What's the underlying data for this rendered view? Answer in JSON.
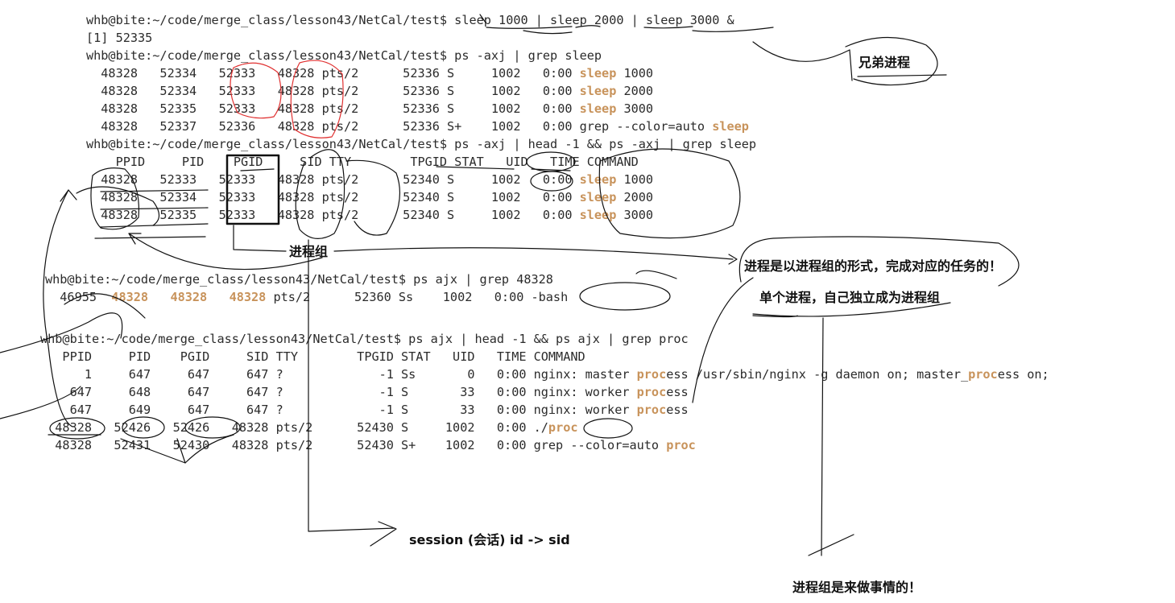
{
  "colors": {
    "background": "#ffffff",
    "terminal_text": "#2b2b2b",
    "match_highlight": "#c8935b",
    "red_ink": "#e03030",
    "pen_ink": "#111111"
  },
  "terminal": {
    "block1": {
      "cmd1": "whb@bite:~/code/merge_class/lesson43/NetCal/test$ sleep 1000 | sleep 2000 | sleep 3000 &",
      "job": "[1] 52335",
      "cmd2": "whb@bite:~/code/merge_class/lesson43/NetCal/test$ ps -axj | grep sleep",
      "rows": [
        {
          "pre": "  48328   52334   52333   48328 pts/2      52336 S     1002   0:00 ",
          "m": "sleep",
          "post": " 1000",
          "pre_b": "",
          "post_b": ""
        },
        {
          "pre": "  48328   52334   52333   48328 pts/2      52336 S     1002   0:00 ",
          "m": "sleep",
          "post": " 2000"
        },
        {
          "pre": "  48328   52335   52333   48328 pts/2      52336 S     1002   0:00 ",
          "m": "sleep",
          "post": " 3000"
        },
        {
          "pre": "  48328   52337   52336   48328 pts/2      52336 S+    1002   0:00 grep --color=auto ",
          "m": "sleep",
          "post": ""
        }
      ]
    },
    "block2": {
      "cmd": "whb@bite:~/code/merge_class/lesson43/NetCal/test$ ps -axj | head -1 && ps -axj | grep sleep",
      "header": "    PPID     PID    PGID     SID TTY        TPGID STAT   UID   TIME COMMAND",
      "rows": [
        {
          "pre": "  48328   52333   52333   48328 pts/2      52340 S     1002   0:00 ",
          "m": "sleep",
          "post": " 1000"
        },
        {
          "pre": "  48328   52334   52333   48328 pts/2      52340 S     1002   0:00 ",
          "m": "sleep",
          "post": " 2000"
        },
        {
          "pre": "  48328   52335   52333   48328 pts/2      52340 S     1002   0:00 ",
          "m": "sleep",
          "post": " 3000"
        }
      ]
    },
    "block3": {
      "cmd": "whb@bite:~/code/merge_class/lesson43/NetCal/test$ ps ajx | grep 48328",
      "row_pre": "  46955  ",
      "row_m1": "48328",
      "row_sep1": "   ",
      "row_m2": "48328",
      "row_sep2": "   ",
      "row_m3": "48328",
      "row_post": " pts/2      52360 Ss    1002   0:00 -bash"
    },
    "block4": {
      "cmd": "whb@bite:~/code/merge_class/lesson43/NetCal/test$ ps ajx | head -1 && ps ajx | grep proc",
      "header": "   PPID     PID    PGID     SID TTY        TPGID STAT   UID   TIME COMMAND",
      "rows": [
        {
          "a": "      1     647     647     647 ?             -1 Ss       0   0:00 nginx: master ",
          "m1": "proc",
          "b": "ess /usr/sbin/nginx -g daemon on; master_",
          "m2": "proc",
          "c": "ess on;"
        },
        {
          "a": "    647     648     647     647 ?             -1 S       33   0:00 nginx: worker ",
          "m1": "proc",
          "b": "ess",
          "m2": "",
          "c": ""
        },
        {
          "a": "    647     649     647     647 ?             -1 S       33   0:00 nginx: worker ",
          "m1": "proc",
          "b": "ess",
          "m2": "",
          "c": ""
        },
        {
          "a": "  48328   52426   52426   48328 pts/2      52430 S     1002   0:00 ./",
          "m1": "proc",
          "b": "",
          "m2": "",
          "c": ""
        },
        {
          "a": "  48328   52431   52430   48328 pts/2      52430 S+    1002   0:00 grep --color=auto ",
          "m1": "proc",
          "b": "",
          "m2": "",
          "c": ""
        }
      ]
    }
  },
  "annotations": {
    "siblings": "兄弟进程",
    "process_group": "进程组",
    "tasks": "进程是以进程组的形式，完成对应的任务的！",
    "single": "单个进程，自己独立成为进程组",
    "session": "session (会话) id -> sid",
    "doing_things": "进程组是来做事情的！"
  }
}
